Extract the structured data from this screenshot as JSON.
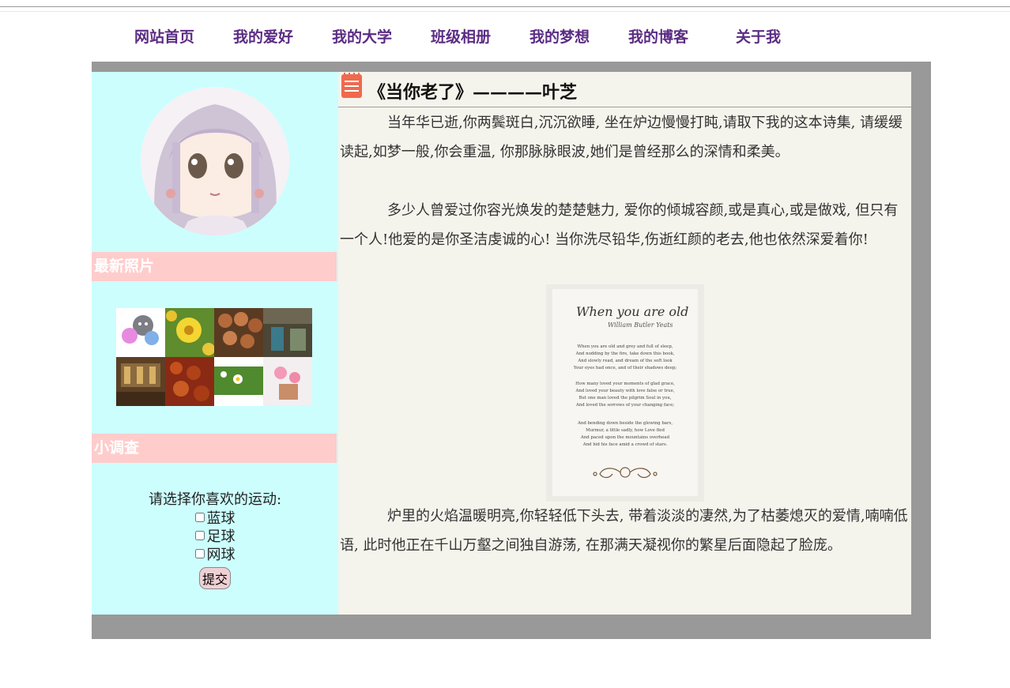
{
  "nav": {
    "items": [
      "网站首页",
      "我的爱好",
      "我的大学",
      "班级相册",
      "我的梦想",
      "我的博客",
      "关于我"
    ]
  },
  "sidebar": {
    "photos_heading": "最新照片",
    "survey_heading": "小调查",
    "survey": {
      "question": "请选择你喜欢的运动:",
      "options": [
        "蓝球",
        "足球",
        "网球"
      ],
      "submit_label": "提交"
    }
  },
  "article": {
    "title": "《当你老了》————叶芝",
    "paragraphs": [
      "当年华已逝,你两鬓斑白,沉沉欲睡, 坐在炉边慢慢打盹,请取下我的这本诗集, 请缓缓读起,如梦一般,你会重温, 你那脉脉眼波,她们是曾经那么的深情和柔美。",
      "多少人曾爱过你容光焕发的楚楚魅力, 爱你的倾城容颜,或是真心,或是做戏, 但只有一个人!他爱的是你圣洁虔诚的心! 当你洗尽铅华,伤逝红颜的老去,他也依然深爱着你!",
      "炉里的火焰温暖明亮,你轻轻低下头去, 带着淡淡的凄然,为了枯萎熄灭的爱情,喃喃低语, 此时他正在千山万壑之间独自游荡, 在那满天凝视你的繁星后面隐起了脸庞。"
    ],
    "poem_image": {
      "title": "When you are old",
      "author": "William Butler Yeats",
      "lines": [
        "When you are old and grey and full of sleep,",
        "And nodding by the fire, take down this book,",
        "And slowly read, and dream of the soft look",
        "Your eyes had once, and of their shadows deep;",
        "How many loved your moments of glad grace,",
        "And loved your beauty with love false or true,",
        "But one man loved the pilgrim Soul in you,",
        "And loved the sorrows of your changing face;",
        "And bending down beside the glowing bars,",
        "Murmur, a little sadly, how Love fled",
        "And paced upon the mountains overhead",
        "And hid his face amid a crowd of stars."
      ]
    }
  },
  "colors": {
    "nav_text": "#5b2c83",
    "sidebar_bg": "#ccfefe",
    "section_head_bg": "#ffcccc",
    "frame_bg": "#999999",
    "content_bg": "#f5f4ec",
    "icon_accent": "#ef6a4d"
  }
}
